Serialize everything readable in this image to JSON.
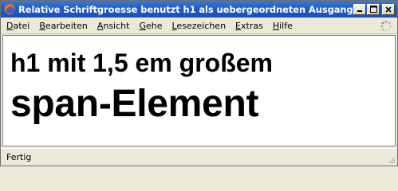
{
  "window": {
    "title": "Relative Schriftgroesse benutzt h1 als uebergeordneten Ausgangswert -..."
  },
  "window_buttons": {
    "minimize_glyph": "_",
    "maximize_glyph": "□",
    "close_glyph": "✕"
  },
  "menu": {
    "items": [
      {
        "accel": "D",
        "rest": "atei"
      },
      {
        "accel": "B",
        "rest": "earbeiten"
      },
      {
        "accel": "A",
        "rest": "nsicht"
      },
      {
        "accel": "G",
        "rest": "ehe"
      },
      {
        "accel": "L",
        "rest": "esezeichen"
      },
      {
        "accel": "E",
        "rest": "xtras"
      },
      {
        "accel": "H",
        "rest": "ilfe"
      }
    ]
  },
  "page": {
    "heading": "h1 mit 1,5 em großem",
    "span": "span-Element"
  },
  "status": {
    "text": "Fertig"
  },
  "colors": {
    "titlebar": "#1f5bc6",
    "chrome": "#ece9d8",
    "content_bg": "#ffffff"
  },
  "icons": {
    "app": "firefox-icon",
    "throbber": "throbber-icon",
    "grip": "resize-grip-icon"
  }
}
